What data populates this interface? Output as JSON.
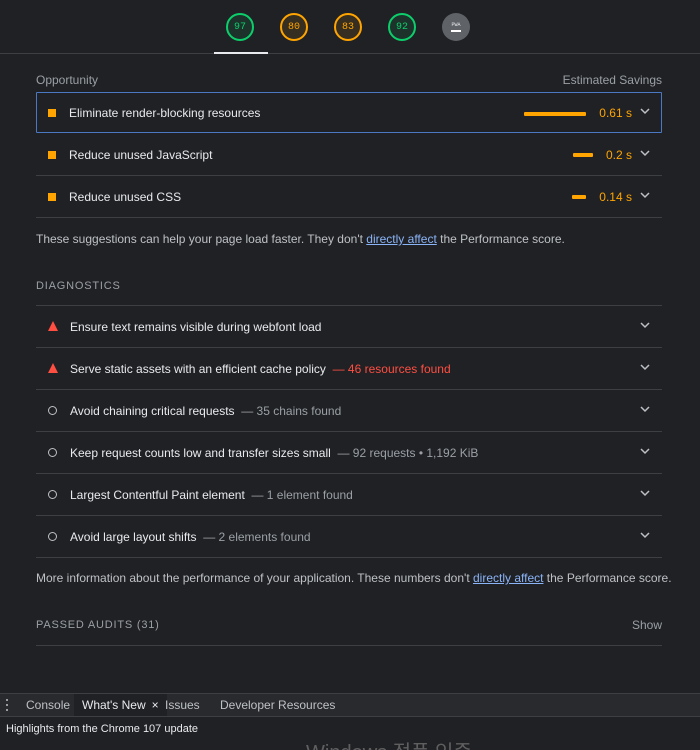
{
  "scores": [
    {
      "value": "97",
      "status": "good"
    },
    {
      "value": "80",
      "status": "average"
    },
    {
      "value": "83",
      "status": "average"
    },
    {
      "value": "92",
      "status": "good"
    },
    {
      "value": "PWA",
      "status": "na"
    }
  ],
  "colors": {
    "pass": "#0cce6b",
    "average": "#ffa400",
    "fail": "#ff4e42",
    "link": "#8ab4f8"
  },
  "opportunity": {
    "header_left": "Opportunity",
    "header_right": "Estimated Savings",
    "items": [
      {
        "title": "Eliminate render-blocking resources",
        "savings": "0.61 s",
        "savings_value_s": 0.61
      },
      {
        "title": "Reduce unused JavaScript",
        "savings": "0.2 s",
        "savings_value_s": 0.2
      },
      {
        "title": "Reduce unused CSS",
        "savings": "0.14 s",
        "savings_value_s": 0.14
      }
    ],
    "note_prefix": "These suggestions can help your page load faster. They don't ",
    "note_link": "directly affect",
    "note_suffix": " the Performance score."
  },
  "diagnostics": {
    "label": "DIAGNOSTICS",
    "items": [
      {
        "title": "Ensure text remains visible during webfont load",
        "detail": "",
        "icon": "fail-triangle-icon"
      },
      {
        "title": "Serve static assets with an efficient cache policy",
        "detail": "— 46 resources found",
        "icon": "fail-triangle-icon"
      },
      {
        "title": "Avoid chaining critical requests",
        "detail": "— 35 chains found",
        "icon": "info-circle-icon"
      },
      {
        "title": "Keep request counts low and transfer sizes small",
        "detail": "— 92 requests • 1,192 KiB",
        "icon": "info-circle-icon"
      },
      {
        "title": "Largest Contentful Paint element",
        "detail": "— 1 element found",
        "icon": "info-circle-icon"
      },
      {
        "title": "Avoid large layout shifts",
        "detail": "— 2 elements found",
        "icon": "info-circle-icon"
      }
    ],
    "note_prefix": "More information about the performance of your application. These numbers don't ",
    "note_link": "directly affect",
    "note_suffix": " the Performance score."
  },
  "passed": {
    "label": "PASSED AUDITS (31)",
    "toggle": "Show"
  },
  "drawer": {
    "tabs": [
      "Console",
      "What's New",
      "Issues",
      "Developer Resources"
    ],
    "active_tab": "What's New",
    "close": "×",
    "highlight": "Highlights from the Chrome 107 update"
  },
  "watermark": "Windows 정품 인증"
}
